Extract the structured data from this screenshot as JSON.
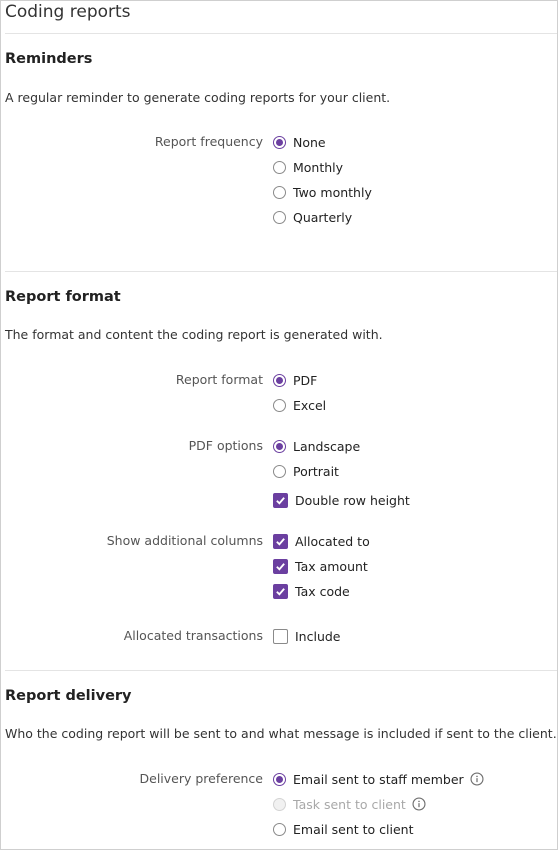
{
  "page": {
    "title": "Coding reports"
  },
  "colors": {
    "accent": "#6b3fa0",
    "disabled": "#a8a8a8",
    "label": "#555555"
  },
  "reminders": {
    "heading": "Reminders",
    "description": "A regular reminder to generate coding reports for your client.",
    "frequency": {
      "label": "Report frequency",
      "options": [
        "None",
        "Monthly",
        "Two monthly",
        "Quarterly"
      ],
      "selected": "None"
    }
  },
  "report_format": {
    "heading": "Report format",
    "description": "The format and content the coding report is generated with.",
    "format": {
      "label": "Report format",
      "options": [
        "PDF",
        "Excel"
      ],
      "selected": "PDF"
    },
    "pdf_options": {
      "label": "PDF options",
      "orientation_options": [
        "Landscape",
        "Portrait"
      ],
      "orientation_selected": "Landscape",
      "double_row_height": {
        "label": "Double row height",
        "checked": true
      }
    },
    "additional_columns": {
      "label": "Show additional columns",
      "items": [
        {
          "label": "Allocated to",
          "checked": true
        },
        {
          "label": "Tax amount",
          "checked": true
        },
        {
          "label": "Tax code",
          "checked": true
        }
      ]
    },
    "allocated_transactions": {
      "label": "Allocated transactions",
      "include": {
        "label": "Include",
        "checked": false
      }
    }
  },
  "report_delivery": {
    "heading": "Report delivery",
    "description": "Who the coding report will be sent to and what message is included if sent to the client.",
    "preference": {
      "label": "Delivery preference",
      "options": [
        {
          "label": "Email sent to staff member",
          "selected": true,
          "disabled": false,
          "info_icon": "info-icon"
        },
        {
          "label": "Task sent to client",
          "selected": false,
          "disabled": true,
          "info_icon": "info-icon"
        },
        {
          "label": "Email sent to client",
          "selected": false,
          "disabled": false
        }
      ]
    }
  }
}
